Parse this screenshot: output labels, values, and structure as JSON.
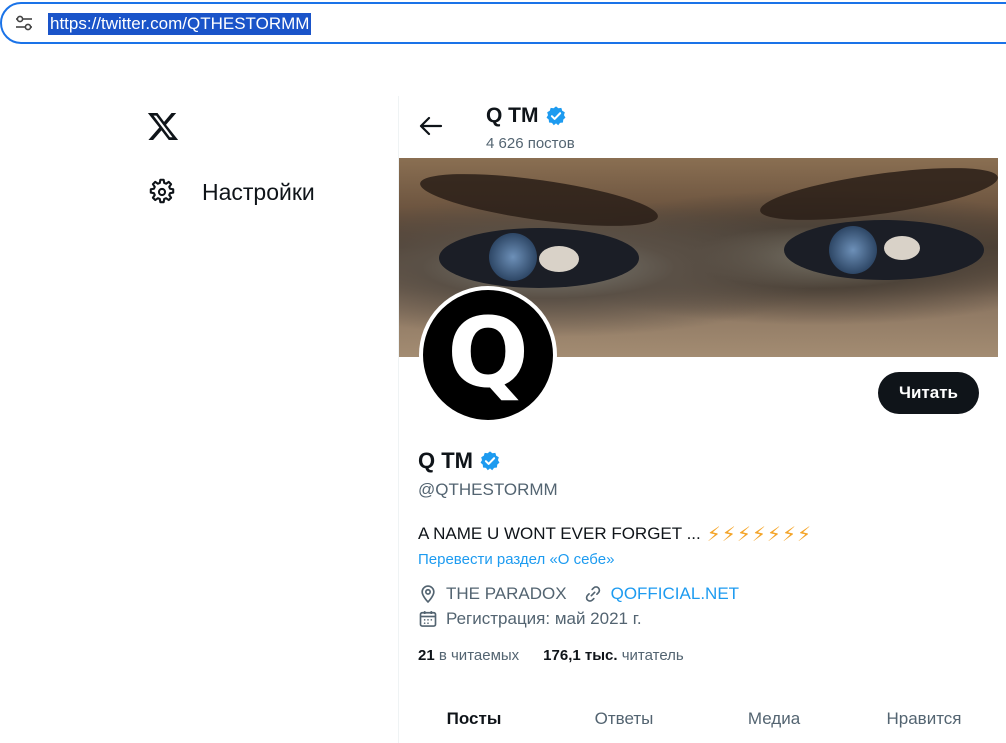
{
  "browser": {
    "url": "https://twitter.com/QTHESTORMM"
  },
  "nav": {
    "settings_label": "Настройки"
  },
  "header": {
    "name": "Q TM",
    "posts_count": "4 626 постов"
  },
  "profile": {
    "avatar_letter": "Q",
    "follow_button": "Читать",
    "name": "Q TM",
    "handle": "@QTHESTORMM",
    "bio_text": "A NAME U WONT EVER FORGET ...",
    "bio_emoji": "⚡⚡⚡⚡⚡⚡⚡",
    "translate_link": "Перевести раздел «О себе»",
    "location": "THE PARADOX",
    "website": "QOFFICIAL.NET",
    "joined": "Регистрация: май 2021 г.",
    "following_count": "21",
    "following_label": "в читаемых",
    "followers_count": "176,1 тыс.",
    "followers_label": "читатель"
  },
  "tabs": [
    {
      "label": "Посты",
      "active": true
    },
    {
      "label": "Ответы",
      "active": false
    },
    {
      "label": "Медиа",
      "active": false
    },
    {
      "label": "Нравится",
      "active": false
    }
  ],
  "colors": {
    "accent": "#1d9bf0",
    "url_highlight": "#1a54c9",
    "verified": "#1d9bf0",
    "bolt": "#f4a52a"
  },
  "icons": [
    "tune-icon",
    "x-logo-icon",
    "gear-icon",
    "back-arrow-icon",
    "verified-badge-icon",
    "location-icon",
    "link-icon",
    "calendar-icon"
  ]
}
